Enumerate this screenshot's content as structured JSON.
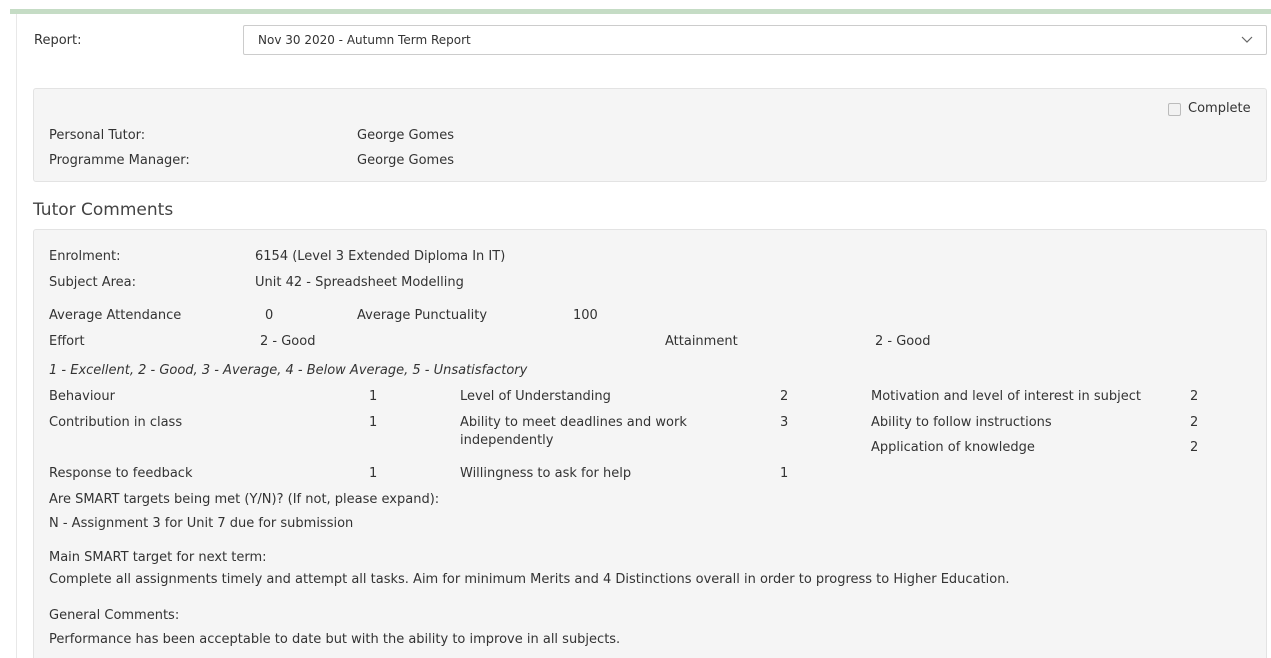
{
  "report": {
    "label": "Report:",
    "selected": "Nov 30 2020 - Autumn Term Report"
  },
  "summary": {
    "complete_label": "Complete",
    "personal_tutor_label": "Personal Tutor:",
    "personal_tutor_value": "George Gomes",
    "programme_manager_label": "Programme Manager:",
    "programme_manager_value": "George Gomes"
  },
  "tutor_comments": {
    "title": "Tutor Comments",
    "enrolment_label": "Enrolment:",
    "enrolment_value": "6154 (Level 3 Extended Diploma In IT)",
    "subject_area_label": "Subject Area:",
    "subject_area_value": "Unit 42 - Spreadsheet Modelling",
    "avg_attendance_label": "Average Attendance",
    "avg_attendance_value": "0",
    "avg_punctuality_label": "Average Punctuality",
    "avg_punctuality_value": "100",
    "effort_label": "Effort",
    "effort_value": "2 - Good",
    "attainment_label": "Attainment",
    "attainment_value": "2 - Good",
    "scale_legend": "1 - Excellent, 2 - Good, 3 - Average, 4 - Below Average, 5 - Unsatisfactory",
    "ratings": {
      "behaviour_label": "Behaviour",
      "behaviour_value": "1",
      "understanding_label": "Level of Understanding",
      "understanding_value": "2",
      "motivation_label": "Motivation and level of interest in subject",
      "motivation_value": "2",
      "contribution_label": "Contribution in class",
      "contribution_value": "1",
      "deadlines_label_line1": "Ability to meet deadlines and work",
      "deadlines_label_line2": "independently",
      "deadlines_value": "3",
      "instructions_label": "Ability to follow instructions",
      "instructions_value": "2",
      "application_label": "Application of knowledge",
      "application_value": "2",
      "feedback_label": "Response to feedback",
      "feedback_value": "1",
      "ask_help_label": "Willingness to ask for help",
      "ask_help_value": "1"
    },
    "smart_met_label": "Are SMART targets being met (Y/N)? (If not, please expand):",
    "smart_met_value": "N - Assignment 3 for Unit 7 due for submission",
    "main_target_label": "Main SMART target for next term:",
    "main_target_value": "Complete all assignments timely and attempt all tasks. Aim for minimum Merits and 4 Distinctions overall in order to progress to Higher Education.",
    "general_comments_label": "General Comments:",
    "general_comments_value": "Performance has been acceptable to date but with the ability to improve in all subjects."
  },
  "icons": {
    "select_arrow": "chevron-down-icon"
  }
}
